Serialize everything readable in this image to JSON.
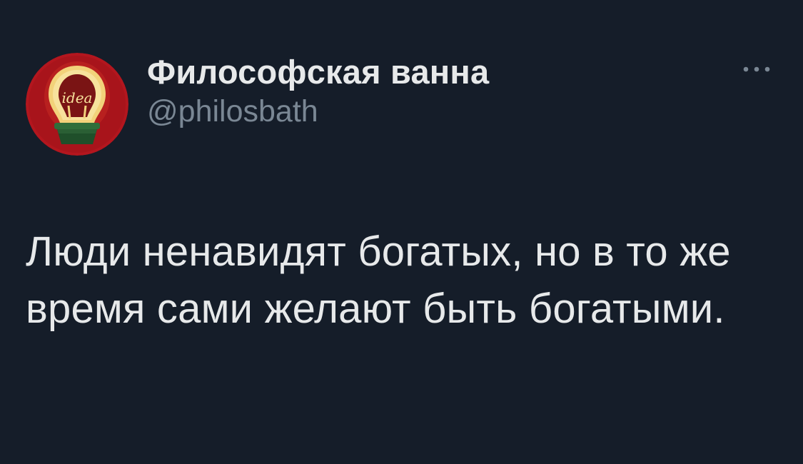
{
  "tweet": {
    "author": {
      "display_name": "Философская ванна",
      "handle": "@philosbath",
      "avatar_label": "idea",
      "avatar_colors": {
        "ring": "#b3161e",
        "bulb": "#f2d27a",
        "pot": "#2f6e3a"
      }
    },
    "more_icon": "more-horizontal-icon",
    "text": "Люди ненавидят богатых, но в то же время сами желают быть богатыми."
  },
  "theme": {
    "background": "#151d29",
    "text": "#e7e9ea",
    "secondary_text": "#7a8794"
  }
}
